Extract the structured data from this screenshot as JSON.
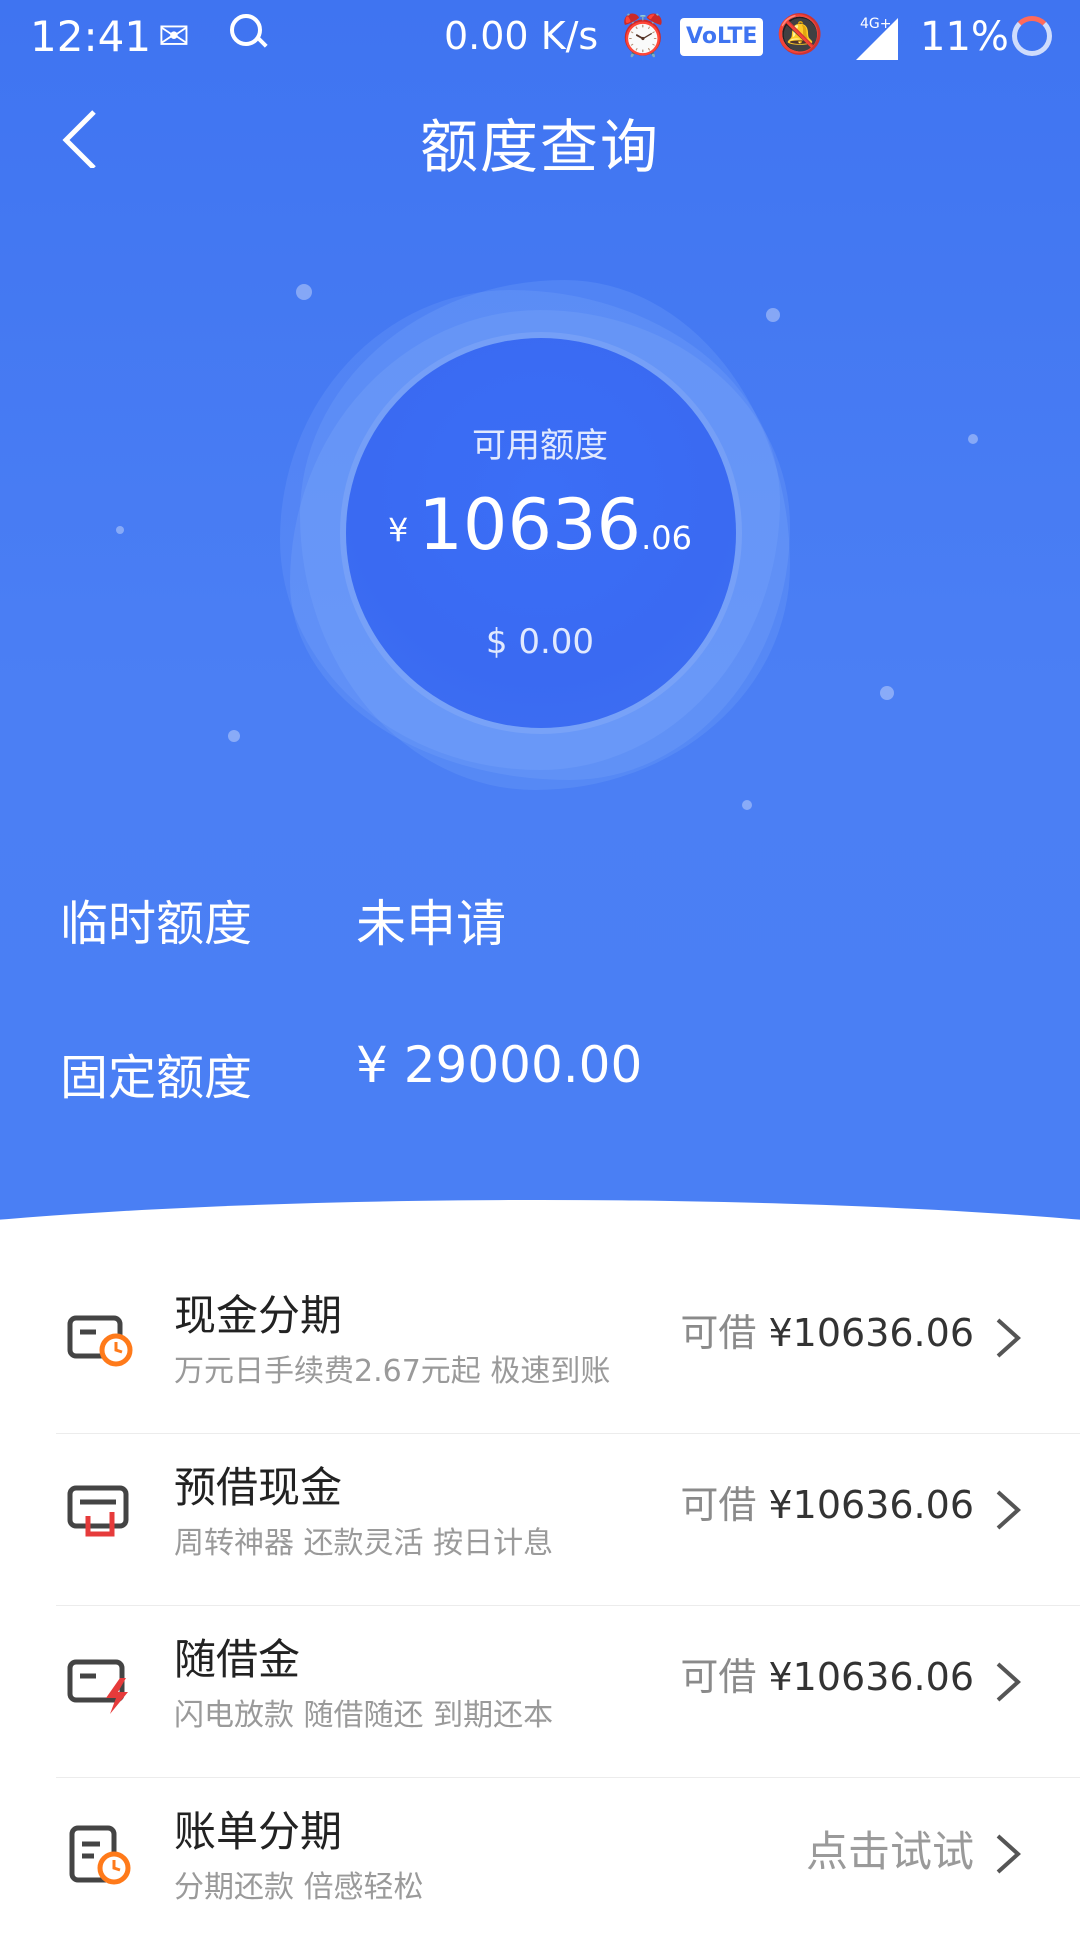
{
  "status_bar": {
    "time": "12:41",
    "net_speed": "0.00 K/s",
    "volte": "VoLTE",
    "battery": "11%",
    "network": "4G+",
    "icons": [
      "wechat-icon",
      "search-icon",
      "alarm-icon",
      "volte-icon",
      "mute-icon",
      "signal-icon",
      "battery-ring-icon"
    ]
  },
  "header": {
    "title": "额度查询",
    "back_icon": "chevron-left-icon"
  },
  "credit": {
    "available_label": "可用额度",
    "currency_symbol": "¥",
    "available_int": "10636",
    "available_dec": ".06",
    "usd": "$ 0.00"
  },
  "rows": {
    "temporary_label": "临时额度",
    "temporary_value": "未申请",
    "fixed_label": "固定额度",
    "fixed_value": "¥ 29000.00"
  },
  "list": [
    {
      "title": "现金分期",
      "subtitle": "万元日手续费2.67元起 极速到账",
      "prefix": "可借",
      "amount": "¥10636.06",
      "icon": "card-clock-icon",
      "accent": "#ff7a1a"
    },
    {
      "title": "预借现金",
      "subtitle": "周转神器 还款灵活 按日计息",
      "prefix": "可借",
      "amount": "¥10636.06",
      "icon": "card-withdraw-icon",
      "accent": "#e63b3b"
    },
    {
      "title": "随借金",
      "subtitle": "闪电放款 随借随还 到期还本",
      "prefix": "可借",
      "amount": "¥10636.06",
      "icon": "card-lightning-icon",
      "accent": "#e63b3b"
    },
    {
      "title": "账单分期",
      "subtitle": "分期还款 倍感轻松",
      "action": "点击试试",
      "icon": "bill-clock-icon",
      "accent": "#ff7a1a"
    }
  ],
  "colors": {
    "primary_blue": "#4a7ff4",
    "white": "#ffffff"
  }
}
